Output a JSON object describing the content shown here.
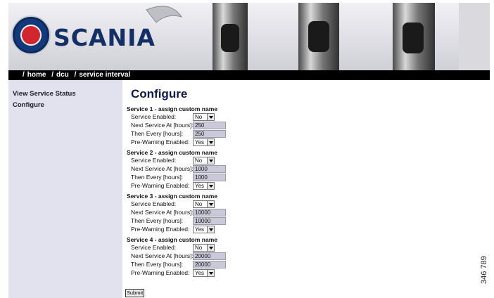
{
  "brand": {
    "name": "SCANIA"
  },
  "breadcrumb": [
    {
      "label": "home"
    },
    {
      "label": "dcu"
    },
    {
      "label": "service interval"
    }
  ],
  "sidebar": {
    "items": [
      {
        "label": "View Service Status"
      },
      {
        "label": "Configure"
      }
    ]
  },
  "main": {
    "title": "Configure",
    "services": [
      {
        "heading": "Service 1 - assign custom name",
        "enabled_label": "Service Enabled:",
        "enabled": "No",
        "next_label": "Next Service At [hours]:",
        "next": "250",
        "every_label": "Then Every [hours]:",
        "every": "250",
        "prewarn_label": "Pre-Warning Enabled:",
        "prewarn": "Yes"
      },
      {
        "heading": "Service 2 - assign custom name",
        "enabled_label": "Service Enabled:",
        "enabled": "No",
        "next_label": "Next Service At [hours]:",
        "next": "1000",
        "every_label": "Then Every [hours]:",
        "every": "1000",
        "prewarn_label": "Pre-Warning Enabled:",
        "prewarn": "Yes"
      },
      {
        "heading": "Service 3 - assign custom name",
        "enabled_label": "Service Enabled:",
        "enabled": "No",
        "next_label": "Next Service At [hours]:",
        "next": "10000",
        "every_label": "Then Every [hours]:",
        "every": "10000",
        "prewarn_label": "Pre-Warning Enabled:",
        "prewarn": "Yes"
      },
      {
        "heading": "Service 4 - assign custom name",
        "enabled_label": "Service Enabled:",
        "enabled": "No",
        "next_label": "Next Service At [hours]:",
        "next": "20000",
        "every_label": "Then Every [hours]:",
        "every": "20000",
        "prewarn_label": "Pre-Warning Enabled:",
        "prewarn": "Yes"
      }
    ],
    "submit_label": "Submit"
  },
  "figure_id": "346 789",
  "colors": {
    "brand_blue": "#132f66",
    "brand_red": "#d2262e",
    "sidebar_bg": "#e2e2ee",
    "field_bg": "#c9c9d9"
  },
  "icons": {
    "logo": "scania-griffin-icon",
    "dropdown": "chevron-down-icon"
  }
}
